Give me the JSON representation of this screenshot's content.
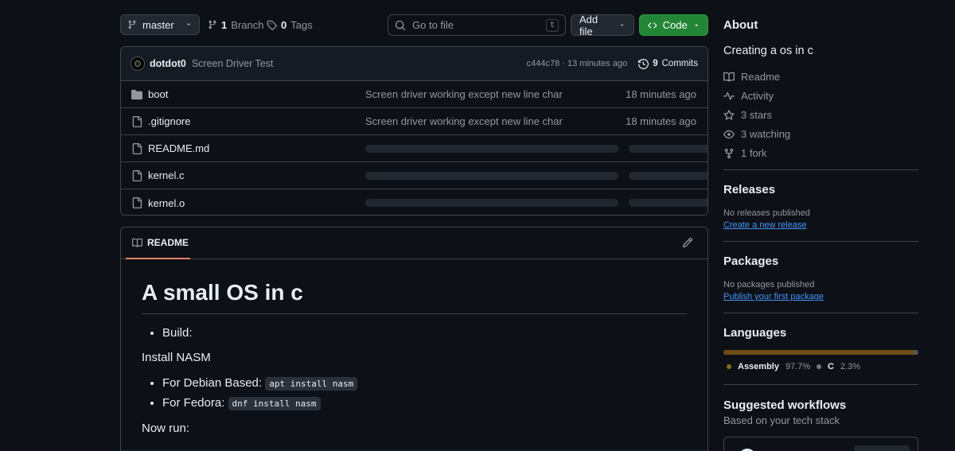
{
  "toolbar": {
    "branch": "master",
    "branches_count": "1",
    "branches_label": "Branch",
    "tags_count": "0",
    "tags_label": "Tags",
    "goto_placeholder": "Go to file",
    "goto_shortcut": "t",
    "add_file_label": "Add file",
    "code_label": "Code"
  },
  "commit": {
    "author": "dotdot0",
    "message": "Screen Driver Test",
    "hash": "c444c78",
    "separator": "·",
    "time": "13 minutes ago",
    "commits_count": "9",
    "commits_label": "Commits"
  },
  "files": [
    {
      "name": "boot",
      "type": "folder",
      "message": "Screen driver working except new line char",
      "date": "18 minutes ago"
    },
    {
      "name": ".gitignore",
      "type": "file",
      "message": "Screen driver working except new line char",
      "date": "18 minutes ago"
    },
    {
      "name": "README.md",
      "type": "file",
      "message": "",
      "date": ""
    },
    {
      "name": "kernel.c",
      "type": "file",
      "message": "",
      "date": ""
    },
    {
      "name": "kernel.o",
      "type": "file",
      "message": "",
      "date": ""
    }
  ],
  "readme": {
    "tab_label": "README",
    "title": "A small OS in c",
    "build_label": "Build:",
    "install_text": "Install NASM",
    "debian_label": "For Debian Based:",
    "debian_cmd": "apt install nasm",
    "fedora_label": "For Fedora:",
    "fedora_cmd": "dnf install nasm",
    "run_text": "Now run:"
  },
  "sidebar": {
    "about_title": "About",
    "description": "Creating a os in c",
    "readme_label": "Readme",
    "activity_label": "Activity",
    "stars_label": "3 stars",
    "watching_label": "3 watching",
    "fork_label": "1 fork",
    "releases_title": "Releases",
    "releases_empty": "No releases published",
    "releases_link": "Create a new release",
    "packages_title": "Packages",
    "packages_empty": "No packages published",
    "packages_link": "Publish your first package",
    "languages_title": "Languages",
    "languages": [
      {
        "name": "Assembly",
        "percent": "97.7%",
        "value": 97.7,
        "color": "#6E4C13"
      },
      {
        "name": "C",
        "percent": "2.3%",
        "value": 2.3,
        "color": "#555555"
      }
    ],
    "workflows_title": "Suggested workflows",
    "workflows_subtitle": "Based on your tech stack"
  }
}
